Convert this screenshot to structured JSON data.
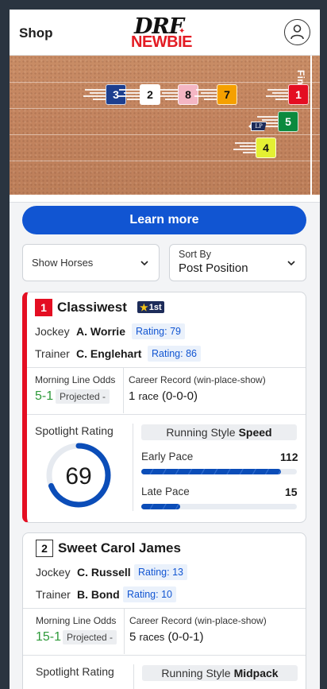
{
  "header": {
    "shop_label": "Shop",
    "logo_top": "DRF",
    "logo_bottom": "NEWBIE"
  },
  "track": {
    "finish_label": "Finish",
    "lp_label": "LP",
    "horses": [
      {
        "number": "3",
        "bg": "#1d3f8f",
        "fg": "#ffffff"
      },
      {
        "number": "2",
        "bg": "#ffffff",
        "fg": "#111111"
      },
      {
        "number": "8",
        "bg": "#f4b6c4",
        "fg": "#111111"
      },
      {
        "number": "7",
        "bg": "#f5a000",
        "fg": "#111111"
      },
      {
        "number": "1",
        "bg": "#e40e22",
        "fg": "#ffffff"
      },
      {
        "number": "5",
        "bg": "#0b8a3e",
        "fg": "#ffffff"
      },
      {
        "number": "4",
        "bg": "#e4f033",
        "fg": "#111111"
      }
    ]
  },
  "learn_more": "Learn more",
  "filters": {
    "show_horses": "Show Horses",
    "sort_label": "Sort By",
    "sort_value": "Post Position"
  },
  "labels": {
    "jockey": "Jockey",
    "trainer": "Trainer",
    "ml_odds": "Morning Line Odds",
    "career": "Career Record (win-place-show)",
    "spotlight": "Spotlight Rating",
    "running_style": "Running Style",
    "early_pace": "Early Pace",
    "late_pace": "Late Pace",
    "projected": "Projected -"
  },
  "horses": [
    {
      "number": "1",
      "name": "Classiwest",
      "badge": "1st",
      "jockey": "A. Worrie",
      "jockey_rating": "Rating: 79",
      "trainer": "C. Englehart",
      "trainer_rating": "Rating: 86",
      "odds": "5-1",
      "career_count": "1",
      "career_unit": "race",
      "career_record": "(0-0-0)",
      "spotlight": "69",
      "spotlight_fraction": 0.69,
      "running_style": "Speed",
      "early_pace": "112",
      "early_fraction": 0.9,
      "late_pace": "15",
      "late_fraction": 0.25
    },
    {
      "number": "2",
      "name": "Sweet Carol James",
      "jockey": "C. Russell",
      "jockey_rating": "Rating: 13",
      "trainer": "B. Bond",
      "trainer_rating": "Rating: 10",
      "odds": "15-1",
      "career_count": "5",
      "career_unit": "races",
      "career_record": "(0-0-1)",
      "running_style": "Midpack"
    }
  ],
  "colors": {
    "accent": "#1155d2",
    "odds_green": "#2e9a3a",
    "leader_red": "#e40e22",
    "badge_navy": "#1d2c5a"
  }
}
